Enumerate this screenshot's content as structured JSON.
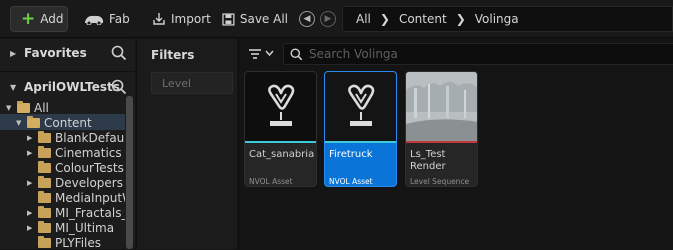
{
  "toolbar": {
    "add_label": "Add",
    "fab_label": "Fab",
    "import_label": "Import",
    "save_all_label": "Save All"
  },
  "breadcrumb": [
    "All",
    "Content",
    "Volinga"
  ],
  "sidebar": {
    "favorites_label": "Favorites",
    "project_label": "AprilOWLTests",
    "tree": [
      {
        "label": "All",
        "depth": 0,
        "expanded": true
      },
      {
        "label": "Content",
        "depth": 1,
        "expanded": true
      },
      {
        "label": "BlankDefault",
        "depth": 2,
        "expanded": false
      },
      {
        "label": "Cinematics",
        "depth": 2,
        "expanded": false
      },
      {
        "label": "ColourTests",
        "depth": 2,
        "expanded": null
      },
      {
        "label": "Developers",
        "depth": 2,
        "expanded": false
      },
      {
        "label": "MediaInputW",
        "depth": 2,
        "expanded": null
      },
      {
        "label": "MI_Fractals_",
        "depth": 2,
        "expanded": false
      },
      {
        "label": "MI_Ultima",
        "depth": 2,
        "expanded": false
      },
      {
        "label": "PLYFiles",
        "depth": 2,
        "expanded": null
      }
    ]
  },
  "filters": {
    "title": "Filters",
    "items": [
      "Level"
    ]
  },
  "content": {
    "search_placeholder": "Search Volinga",
    "assets": [
      {
        "name": "Cat_sanabria",
        "type": "NVOL Asset",
        "selected": false,
        "accent": "#3ecbd9"
      },
      {
        "name": "Firetruck",
        "type": "NVOL Asset",
        "selected": true,
        "accent": "#3ecbd9"
      },
      {
        "name": "Ls_Test Render",
        "type": "Level Sequence",
        "selected": false,
        "accent": "#c0393b"
      }
    ]
  },
  "colors": {
    "accent_blue": "#0b74d8",
    "add_green": "#6bd14b",
    "folder": "#c9a25a"
  }
}
